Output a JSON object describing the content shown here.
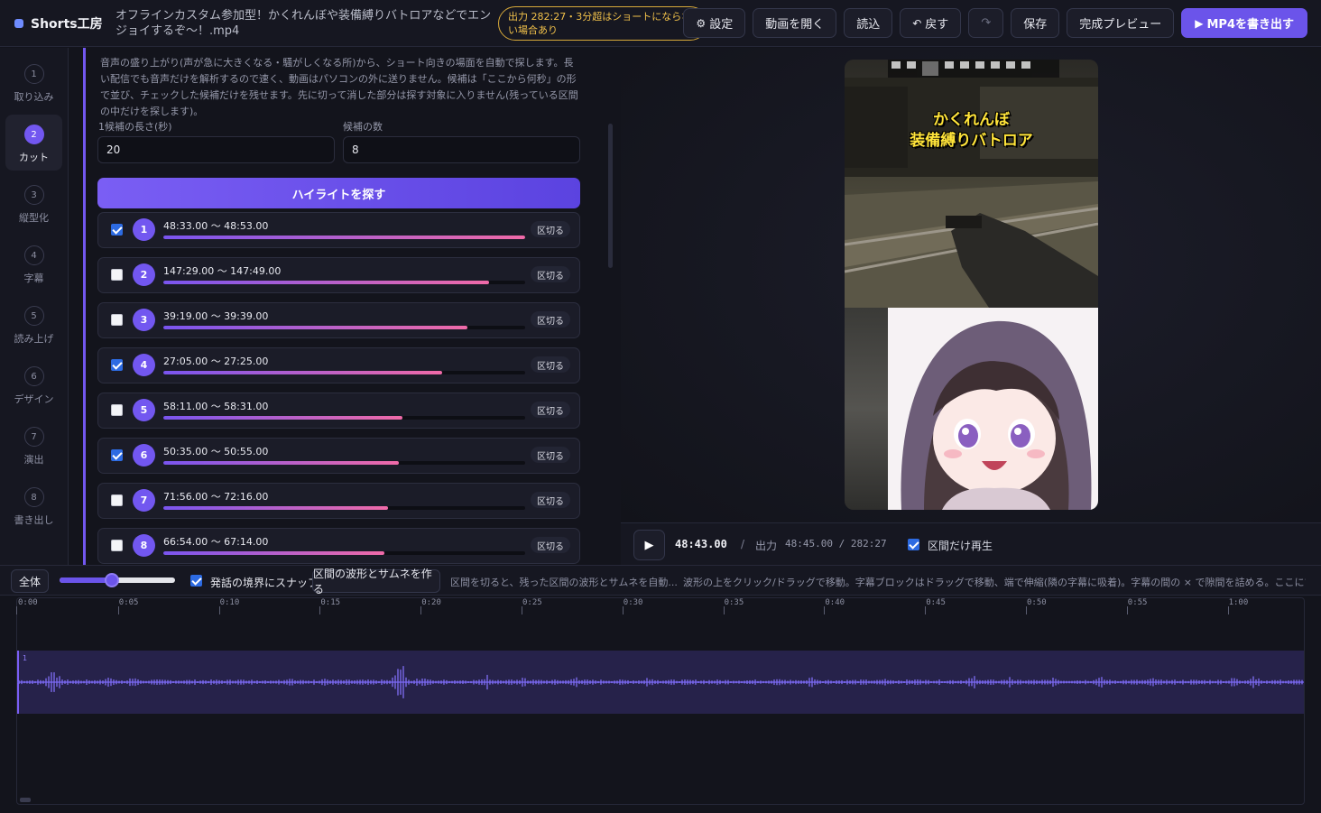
{
  "app": {
    "name": "Shorts工房",
    "file_title": "オフラインカスタム参加型！かくれんぼや装備縛りバトロアなどでエンジョイするぞ〜！.mp4",
    "warning": "出力 282:27・3分超はショートにならない場合あり"
  },
  "toolbar": {
    "settings": "設定",
    "open_video": "動画を開く",
    "load": "読込",
    "undo": "戻す",
    "redo": "↷",
    "save": "保存",
    "preview": "完成プレビュー",
    "export": "MP4を書き出す"
  },
  "steps": [
    {
      "num": "1",
      "label": "取り込み"
    },
    {
      "num": "2",
      "label": "カット"
    },
    {
      "num": "3",
      "label": "縦型化"
    },
    {
      "num": "4",
      "label": "字幕"
    },
    {
      "num": "5",
      "label": "読み上げ"
    },
    {
      "num": "6",
      "label": "デザイン"
    },
    {
      "num": "7",
      "label": "演出"
    },
    {
      "num": "8",
      "label": "書き出し"
    }
  ],
  "highlight": {
    "description": "音声の盛り上がり(声が急に大きくなる・騒がしくなる所)から、ショート向きの場面を自動で探します。長い配信でも音声だけを解析するので速く、動画はパソコンの外に送りません。候補は「ここから何秒」の形で並び、チェックした候補だけを残せます。先に切って消した部分は探す対象に入りません(残っている区間の中だけを探します)。",
    "length_label": "1候補の長さ(秒)",
    "length_value": "20",
    "count_label": "候補の数",
    "count_value": "8",
    "find_button": "ハイライトを探す",
    "cut_label": "区切る",
    "candidates": [
      {
        "num": "1",
        "range": "48:33.00 〜 48:53.00",
        "checked": true,
        "score": 1.0
      },
      {
        "num": "2",
        "range": "147:29.00 〜 147:49.00",
        "checked": false,
        "score": 0.9
      },
      {
        "num": "3",
        "range": "39:19.00 〜 39:39.00",
        "checked": false,
        "score": 0.84
      },
      {
        "num": "4",
        "range": "27:05.00 〜 27:25.00",
        "checked": true,
        "score": 0.77
      },
      {
        "num": "5",
        "range": "58:11.00 〜 58:31.00",
        "checked": false,
        "score": 0.66
      },
      {
        "num": "6",
        "range": "50:35.00 〜 50:55.00",
        "checked": true,
        "score": 0.65
      },
      {
        "num": "7",
        "range": "71:56.00 〜 72:16.00",
        "checked": false,
        "score": 0.62
      },
      {
        "num": "8",
        "range": "66:54.00 〜 67:14.00",
        "checked": false,
        "score": 0.61
      }
    ]
  },
  "preview": {
    "caption_line1": "かくれんぼ",
    "caption_line2": "装備縛りバトロア",
    "current_time": "48:43.00",
    "output_label": "出力",
    "output_value": "48:45.00 / 282:27",
    "range_only_label": "区間だけ再生"
  },
  "timeline_bar": {
    "all_button": "全体",
    "zoom": 0.45,
    "snap_label": "発話の境界にスナップ",
    "wave_button": "区間の波形とサムネを作る",
    "hint_short": "区間を切ると、残った区間の波形とサムネを自動...",
    "hint_long": "波形の上をクリック/ドラッグで移動。字幕ブロックはドラッグで移動、端で伸縮(隣の字幕に吸着)。字幕の間の × で隙間を詰める。ここにマウスを置..."
  },
  "timeline": {
    "ticks": [
      "0:00",
      "0:05",
      "0:10",
      "0:15",
      "0:20",
      "0:25",
      "0:30",
      "0:35",
      "0:40",
      "0:45",
      "0:50",
      "0:55",
      "1:00",
      "1:0"
    ],
    "track_label": "1"
  },
  "colors": {
    "accent": "#7257f0",
    "warning": "#f0c04a",
    "caption": "#ffe43a"
  }
}
